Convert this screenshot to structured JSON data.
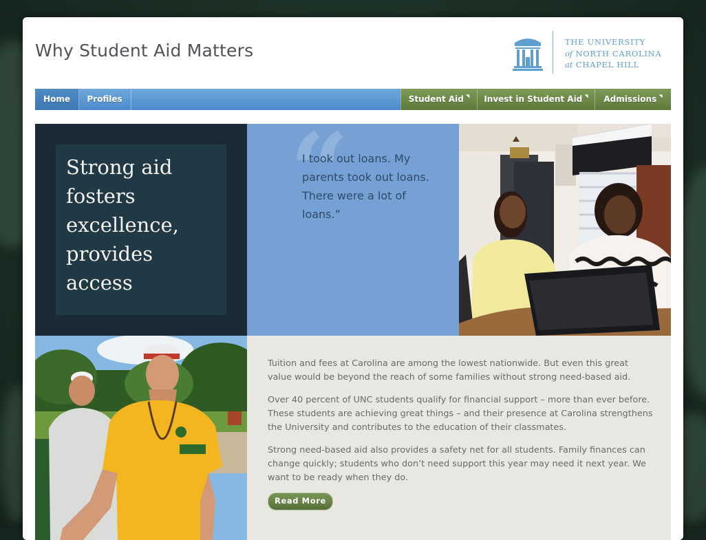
{
  "site": {
    "title": "Why Student Aid Matters"
  },
  "logo": {
    "icon": "old-well-icon",
    "line1": "THE UNIVERSITY",
    "line2_prefix": "of",
    "line2": "NORTH CAROLINA",
    "line3_prefix": "at",
    "line3": "CHAPEL HILL"
  },
  "nav": {
    "left": [
      {
        "label": "Home",
        "active": true
      },
      {
        "label": "Profiles",
        "active": false
      }
    ],
    "right": [
      {
        "label": "Student Aid",
        "has_menu": true
      },
      {
        "label": "Invest in Student Aid",
        "has_menu": true
      },
      {
        "label": "Admissions",
        "has_menu": true
      }
    ],
    "dropdown_glyph": "◥"
  },
  "hero": {
    "tagline": "Strong aid fosters excellence, provides access",
    "quote_mark": "“",
    "quote": "I took out loans. My parents took out loans. There were a lot of loans.”"
  },
  "content": {
    "paragraphs": [
      "Tuition and fees at Carolina are among the lowest nationwide. But even this great value would be beyond the reach of some families without strong need-based aid.",
      "Over 40 percent of UNC students qualify for financial support – more than ever before. These students are achieving great things – and their presence at Carolina strengthens the University and contributes to the education of their classmates.",
      "Strong need-based aid also provides a safety net for all students. Family finances can change quickly; students who don’t need support this year may need it next year. We want to be ready when they do."
    ],
    "read_more": "Read More"
  },
  "colors": {
    "nav_blue": "#5a98d4",
    "nav_green": "#6b8747",
    "dark_panel": "#1b2b35",
    "quote_panel": "#75a1d4",
    "text_panel": "#e8e7e2",
    "unc_blue": "#5f9fd0"
  }
}
